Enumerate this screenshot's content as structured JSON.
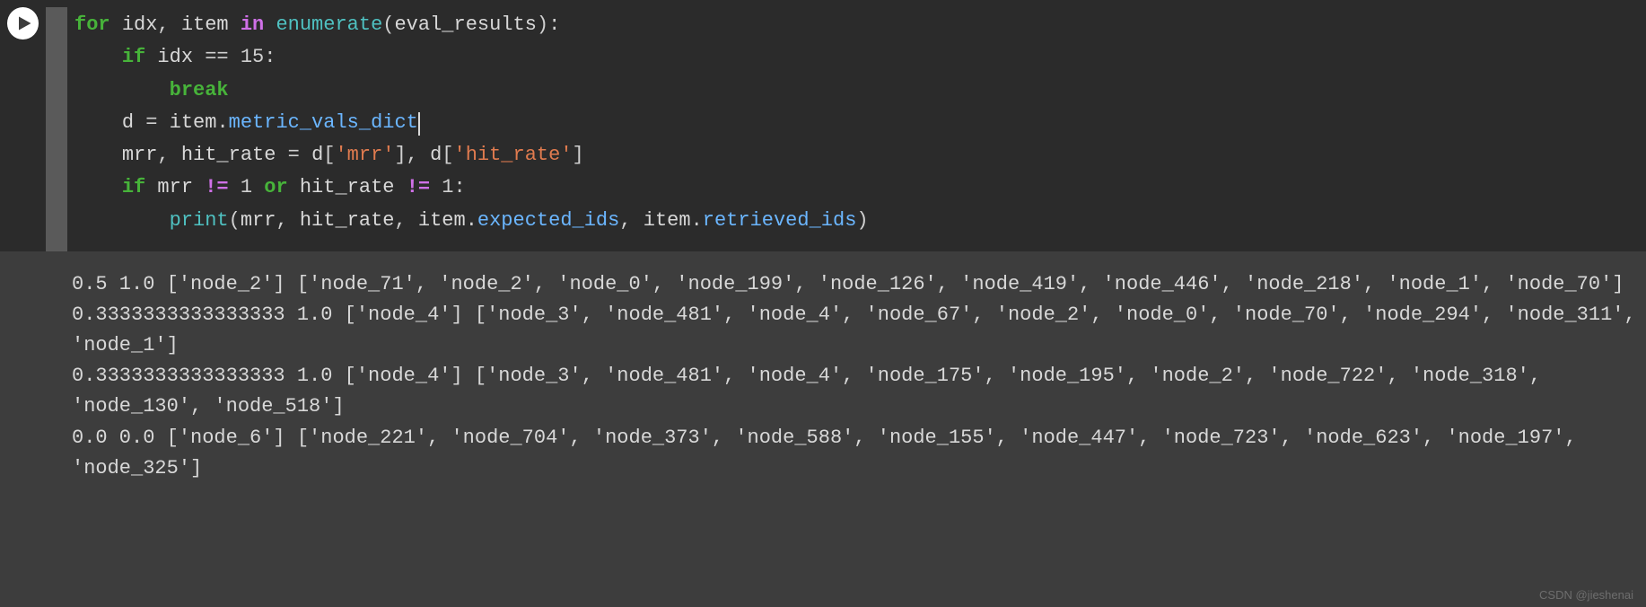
{
  "code": {
    "lines": [
      {
        "tokens": [
          {
            "t": "for ",
            "c": "kw"
          },
          {
            "t": "idx",
            "c": "id"
          },
          {
            "t": ", ",
            "c": "op"
          },
          {
            "t": "item ",
            "c": "id"
          },
          {
            "t": "in ",
            "c": "kw2"
          },
          {
            "t": "enumerate",
            "c": "fn"
          },
          {
            "t": "(",
            "c": "op"
          },
          {
            "t": "eval_results",
            "c": "id"
          },
          {
            "t": "):",
            "c": "op"
          }
        ]
      },
      {
        "indent": 1,
        "tokens": [
          {
            "t": "if ",
            "c": "kw"
          },
          {
            "t": "idx ",
            "c": "id"
          },
          {
            "t": "== ",
            "c": "op"
          },
          {
            "t": "15",
            "c": "num"
          },
          {
            "t": ":",
            "c": "op"
          }
        ]
      },
      {
        "indent": 2,
        "tokens": [
          {
            "t": "break",
            "c": "kw"
          }
        ]
      },
      {
        "indent": 1,
        "tokens": [
          {
            "t": "d ",
            "c": "id"
          },
          {
            "t": "= ",
            "c": "op"
          },
          {
            "t": "item",
            "c": "id"
          },
          {
            "t": ".",
            "c": "op"
          },
          {
            "t": "metric_vals_dict",
            "c": "attr"
          },
          {
            "t": "",
            "c": "cursor-mark"
          }
        ]
      },
      {
        "indent": 1,
        "tokens": [
          {
            "t": "mrr",
            "c": "id"
          },
          {
            "t": ", ",
            "c": "op"
          },
          {
            "t": "hit_rate ",
            "c": "id"
          },
          {
            "t": "= ",
            "c": "op"
          },
          {
            "t": "d",
            "c": "id"
          },
          {
            "t": "[",
            "c": "op"
          },
          {
            "t": "'mrr'",
            "c": "str"
          },
          {
            "t": "], ",
            "c": "op"
          },
          {
            "t": "d",
            "c": "id"
          },
          {
            "t": "[",
            "c": "op"
          },
          {
            "t": "'hit_rate'",
            "c": "str"
          },
          {
            "t": "]",
            "c": "op"
          }
        ]
      },
      {
        "indent": 1,
        "tokens": [
          {
            "t": "if ",
            "c": "kw"
          },
          {
            "t": "mrr ",
            "c": "id"
          },
          {
            "t": "!= ",
            "c": "neq"
          },
          {
            "t": "1 ",
            "c": "num"
          },
          {
            "t": "or ",
            "c": "kw"
          },
          {
            "t": "hit_rate ",
            "c": "id"
          },
          {
            "t": "!= ",
            "c": "neq"
          },
          {
            "t": "1",
            "c": "num"
          },
          {
            "t": ":",
            "c": "op"
          }
        ]
      },
      {
        "indent": 2,
        "tokens": [
          {
            "t": "print",
            "c": "fn"
          },
          {
            "t": "(",
            "c": "op"
          },
          {
            "t": "mrr",
            "c": "id"
          },
          {
            "t": ", ",
            "c": "op"
          },
          {
            "t": "hit_rate",
            "c": "id"
          },
          {
            "t": ", ",
            "c": "op"
          },
          {
            "t": "item",
            "c": "id"
          },
          {
            "t": ".",
            "c": "op"
          },
          {
            "t": "expected_ids",
            "c": "attr"
          },
          {
            "t": ", ",
            "c": "op"
          },
          {
            "t": "item",
            "c": "id"
          },
          {
            "t": ".",
            "c": "op"
          },
          {
            "t": "retrieved_ids",
            "c": "attr"
          },
          {
            "t": ")",
            "c": "op"
          }
        ]
      }
    ]
  },
  "output_lines": [
    "0.5 1.0 ['node_2'] ['node_71', 'node_2', 'node_0', 'node_199', 'node_126', 'node_419', 'node_446', 'node_218', 'node_1', 'node_70']",
    "0.3333333333333333 1.0 ['node_4'] ['node_3', 'node_481', 'node_4', 'node_67', 'node_2', 'node_0', 'node_70', 'node_294', 'node_311', 'node_1']",
    "0.3333333333333333 1.0 ['node_4'] ['node_3', 'node_481', 'node_4', 'node_175', 'node_195', 'node_2', 'node_722', 'node_318', 'node_130', 'node_518']",
    "0.0 0.0 ['node_6'] ['node_221', 'node_704', 'node_373', 'node_588', 'node_155', 'node_447', 'node_723', 'node_623', 'node_197', 'node_325']"
  ],
  "watermark": "CSDN @jieshenai"
}
